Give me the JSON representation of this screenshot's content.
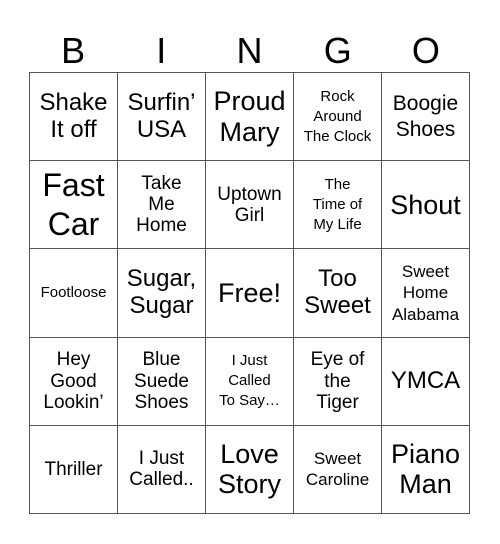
{
  "header": {
    "letters": [
      "B",
      "I",
      "N",
      "G",
      "O"
    ]
  },
  "rows": [
    [
      "Shake\nIt off",
      "Surfin’\nUSA",
      "Proud\nMary",
      "Rock\nAround\nThe Clock",
      "Boogie\nShoes"
    ],
    [
      "Fast\nCar",
      "Take\nMe\nHome",
      "Uptown\nGirl",
      "The\nTime of\nMy Life",
      "Shout"
    ],
    [
      "Footloose",
      "Sugar,\nSugar",
      "Free!",
      "Too\nSweet",
      "Sweet\nHome\nAlabama"
    ],
    [
      "Hey\nGood\nLookin’",
      "Blue\nSuede\nShoes",
      "I Just\nCalled\nTo Say…",
      "Eye of\nthe\nTiger",
      "YMCA"
    ],
    [
      "Thriller",
      "I Just\nCalled..",
      "Love\nStory",
      "Sweet\nCaroline",
      "Piano\nMan"
    ]
  ]
}
